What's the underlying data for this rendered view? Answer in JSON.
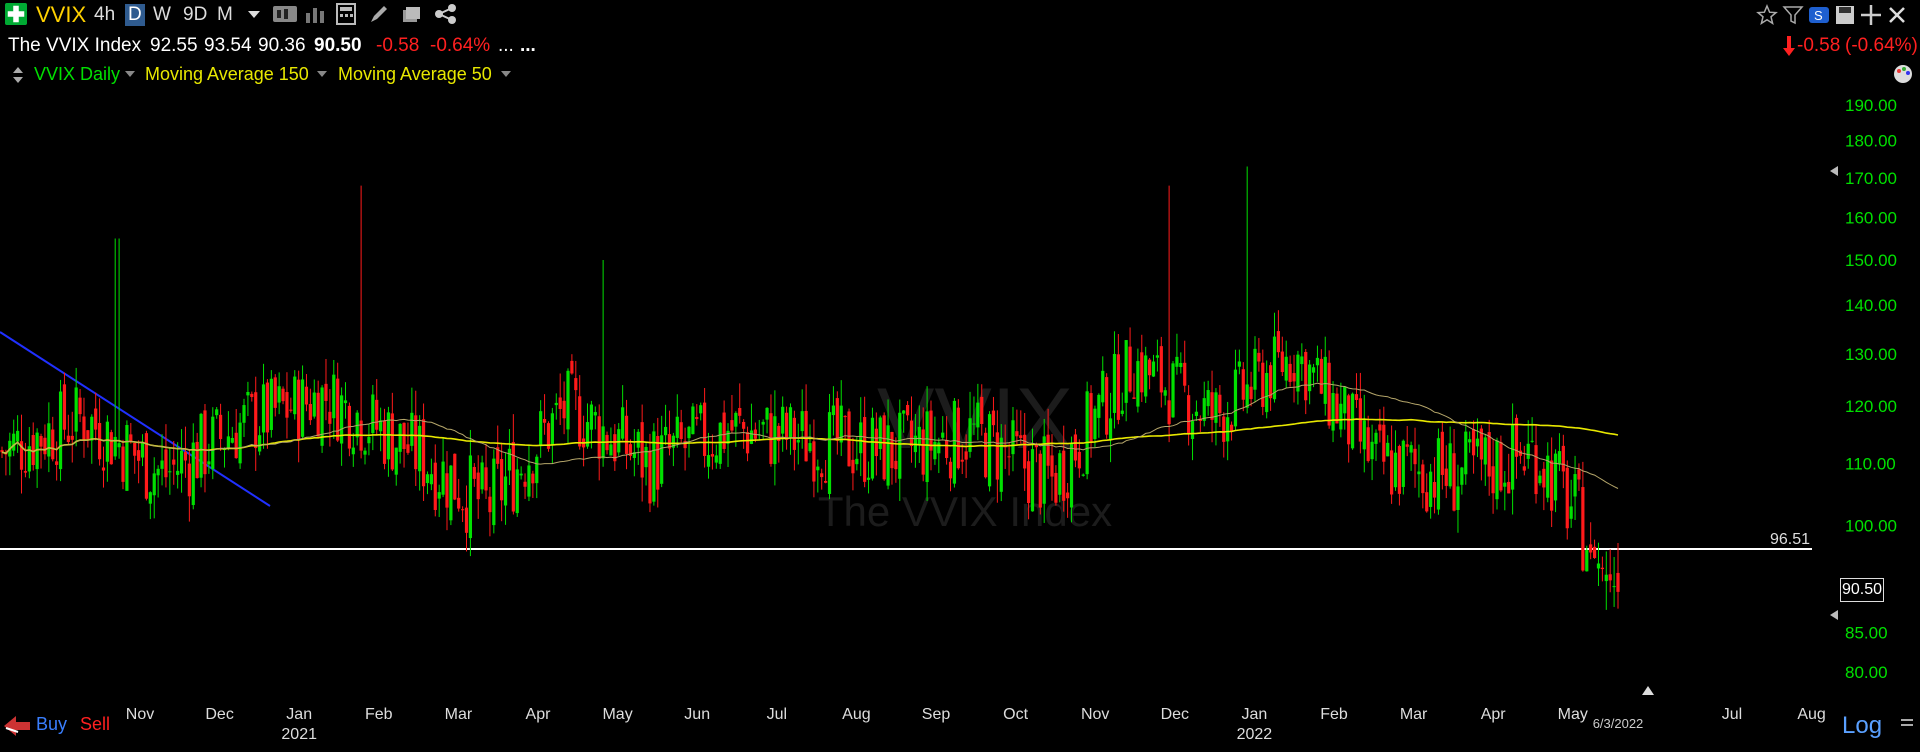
{
  "toolbar": {
    "symbol": "VVIX",
    "timeframes": [
      "4h",
      "D",
      "W",
      "9D",
      "M"
    ],
    "active_timeframe": "D"
  },
  "quote": {
    "name": "The VVIX Index",
    "open": "92.55",
    "high": "93.54",
    "low": "90.36",
    "close": "90.50",
    "change": "-0.58",
    "change_pct": "-0.64%",
    "more": "...",
    "right_change": "-0.58",
    "right_change_pct": "(-0.64%)"
  },
  "legend": {
    "series": "VVIX Daily",
    "ma150": "Moving Average 150",
    "ma50": "Moving Average 50"
  },
  "watermark": {
    "symbol": "VVIX",
    "name": "The VVIX Index"
  },
  "levels": {
    "horizontal_line": "96.51",
    "last_price": "90.50"
  },
  "date_marker": "6/3/2022",
  "bottom": {
    "buy": "Buy",
    "sell": "Sell",
    "scale": "Log"
  },
  "colors": {
    "up": "#00e000",
    "down": "#ff1a1a",
    "ma150": "#e8e800",
    "ma50": "#b5a66a",
    "trendline": "#2030ff",
    "symbol": "#ffd100",
    "axis_text": "#00e000"
  },
  "chart_data": {
    "type": "candlestick",
    "yscale": "log",
    "ylim": [
      78,
      195
    ],
    "y_ticks": [
      "80.00",
      "85.00",
      "100.00",
      "110.00",
      "120.00",
      "130.00",
      "140.00",
      "150.00",
      "160.00",
      "170.00",
      "180.00",
      "190.00"
    ],
    "y_tick_values": [
      80,
      85,
      100,
      110,
      120,
      130,
      140,
      150,
      160,
      170,
      180,
      190
    ],
    "x_labels": [
      {
        "label": "Nov",
        "month": 0
      },
      {
        "label": "Dec",
        "month": 1
      },
      {
        "label": "Jan",
        "month": 2,
        "year": "2021"
      },
      {
        "label": "Feb",
        "month": 3
      },
      {
        "label": "Mar",
        "month": 4
      },
      {
        "label": "Apr",
        "month": 5
      },
      {
        "label": "May",
        "month": 6
      },
      {
        "label": "Jun",
        "month": 7
      },
      {
        "label": "Jul",
        "month": 8
      },
      {
        "label": "Aug",
        "month": 9
      },
      {
        "label": "Sep",
        "month": 10
      },
      {
        "label": "Oct",
        "month": 11
      },
      {
        "label": "Nov",
        "month": 12
      },
      {
        "label": "Dec",
        "month": 13
      },
      {
        "label": "Jan",
        "month": 14,
        "year": "2022"
      },
      {
        "label": "Feb",
        "month": 15
      },
      {
        "label": "Mar",
        "month": 16
      },
      {
        "label": "Apr",
        "month": 17
      },
      {
        "label": "May",
        "month": 18
      },
      {
        "label": "Jul",
        "month": 20
      },
      {
        "label": "Aug",
        "month": 21
      }
    ],
    "monthly_closes": [
      {
        "month": "Oct 2020",
        "value": 112
      },
      {
        "month": "Nov 2020",
        "value": 118
      },
      {
        "month": "Dec 2020",
        "value": 108
      },
      {
        "month": "Jan 2021",
        "value": 117
      },
      {
        "month": "Feb 2021",
        "value": 122
      },
      {
        "month": "Mar 2021",
        "value": 113
      },
      {
        "month": "Apr 2021",
        "value": 103
      },
      {
        "month": "May 2021",
        "value": 120
      },
      {
        "month": "Jun 2021",
        "value": 110
      },
      {
        "month": "Jul 2021",
        "value": 116
      },
      {
        "month": "Aug 2021",
        "value": 114
      },
      {
        "month": "Sep 2021",
        "value": 112
      },
      {
        "month": "Oct 2021",
        "value": 115
      },
      {
        "month": "Nov 2021",
        "value": 107
      },
      {
        "month": "Dec 2021",
        "value": 128
      },
      {
        "month": "Jan 2022",
        "value": 118
      },
      {
        "month": "Feb 2022",
        "value": 130
      },
      {
        "month": "Mar 2022",
        "value": 110
      },
      {
        "month": "Apr 2022",
        "value": 108
      },
      {
        "month": "May 2022",
        "value": 112
      },
      {
        "month": "Jun 2022",
        "value": 90.5
      }
    ],
    "highs": [
      {
        "month": "Nov 2020",
        "value": 155
      },
      {
        "month": "Feb 2021",
        "value": 168
      },
      {
        "month": "May 2021",
        "value": 150
      },
      {
        "month": "Dec 2021",
        "value": 168
      },
      {
        "month": "Jan 2022",
        "value": 173
      }
    ],
    "support_line": 96.51,
    "last_close": 90.5
  }
}
